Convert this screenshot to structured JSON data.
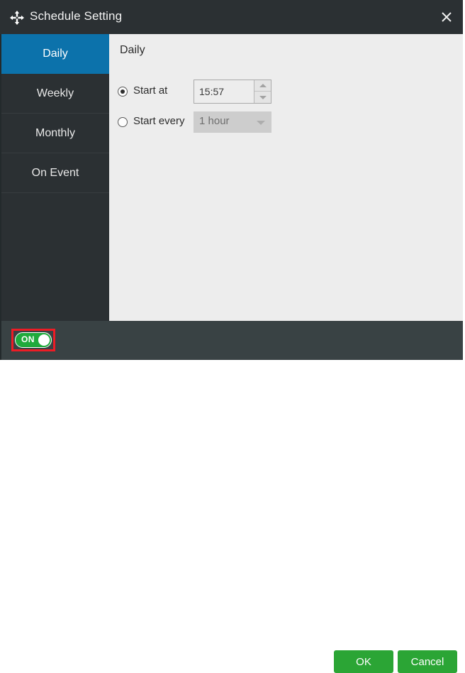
{
  "window": {
    "title": "Schedule Setting",
    "move_icon": "move-icon",
    "close_icon": "close-icon"
  },
  "sidebar": {
    "items": [
      {
        "label": "Daily",
        "selected": true
      },
      {
        "label": "Weekly",
        "selected": false
      },
      {
        "label": "Monthly",
        "selected": false
      },
      {
        "label": "On Event",
        "selected": false
      }
    ]
  },
  "content": {
    "heading": "Daily",
    "start_at": {
      "label": "Start at",
      "selected": true,
      "time_value": "15:57",
      "spinner_up_icon": "chevron-up-icon",
      "spinner_down_icon": "chevron-down-icon"
    },
    "start_every": {
      "label": "Start every",
      "selected": false,
      "interval_value": "1 hour",
      "dropdown_icon": "chevron-down-icon",
      "disabled": true
    }
  },
  "footer": {
    "toggle": {
      "label": "ON",
      "state": "on",
      "highlight_color": "#ee1c25"
    },
    "ok_label": "OK",
    "cancel_label": "Cancel"
  },
  "colors": {
    "titlebar": "#2b3033",
    "sidebar": "#2b3033",
    "sidebar_active": "#0c72ab",
    "content_bg": "#ededed",
    "footer": "#394244",
    "button_green": "#2ba535",
    "toggle_green": "#1faa3c",
    "annotation_red": "#ee1c25"
  }
}
